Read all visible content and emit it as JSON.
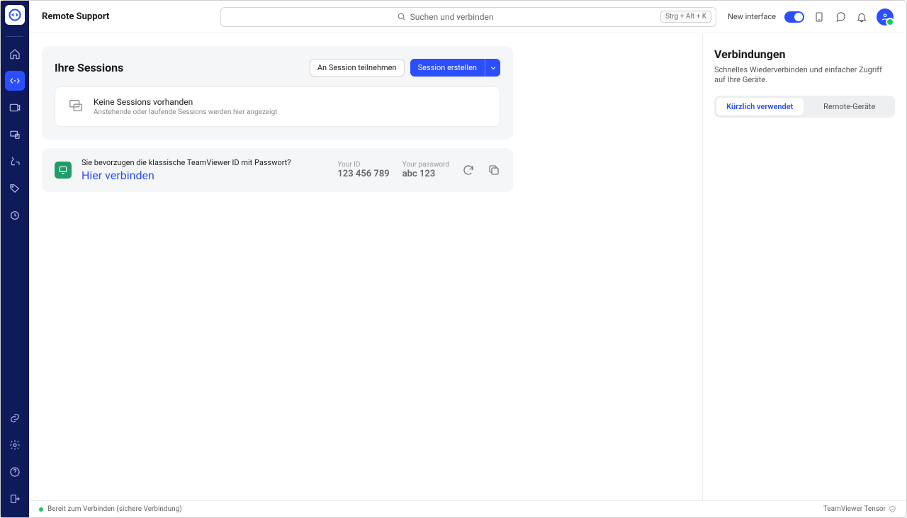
{
  "header": {
    "title": "Remote Support",
    "search_placeholder": "Suchen und verbinden",
    "search_shortcut": "Strg + Alt + K",
    "new_interface_label": "New interface"
  },
  "sidebar": {
    "items": [
      {
        "name": "home"
      },
      {
        "name": "remote-support",
        "active": true
      },
      {
        "name": "meeting"
      },
      {
        "name": "devices"
      },
      {
        "name": "workflows"
      },
      {
        "name": "tags"
      },
      {
        "name": "clock"
      }
    ],
    "bottom": [
      {
        "name": "link"
      },
      {
        "name": "settings"
      },
      {
        "name": "help"
      },
      {
        "name": "exit"
      }
    ]
  },
  "sessions": {
    "title": "Ihre Sessions",
    "join_label": "An Session teilnehmen",
    "create_label": "Session erstellen",
    "empty_title": "Keine Sessions vorhanden",
    "empty_sub": "Anstehende oder laufende Sessions werden hier angezeigt"
  },
  "classic": {
    "text": "Sie bevorzugen die klassische TeamViewer ID mit Passwort?",
    "link": "Hier verbinden",
    "your_id_label": "Your ID",
    "your_id_value": "123 456 789",
    "your_pw_label": "Your password",
    "your_pw_value": "abc 123"
  },
  "right": {
    "title": "Verbindungen",
    "subtitle": "Schnelles Wiederverbinden und einfacher Zugriff auf Ihre Geräte.",
    "tab_recent": "Kürzlich verwendet",
    "tab_remote": "Remote-Geräte"
  },
  "status": {
    "text": "Bereit zum Verbinden (sichere Verbindung)",
    "product": "TeamViewer Tensor"
  }
}
